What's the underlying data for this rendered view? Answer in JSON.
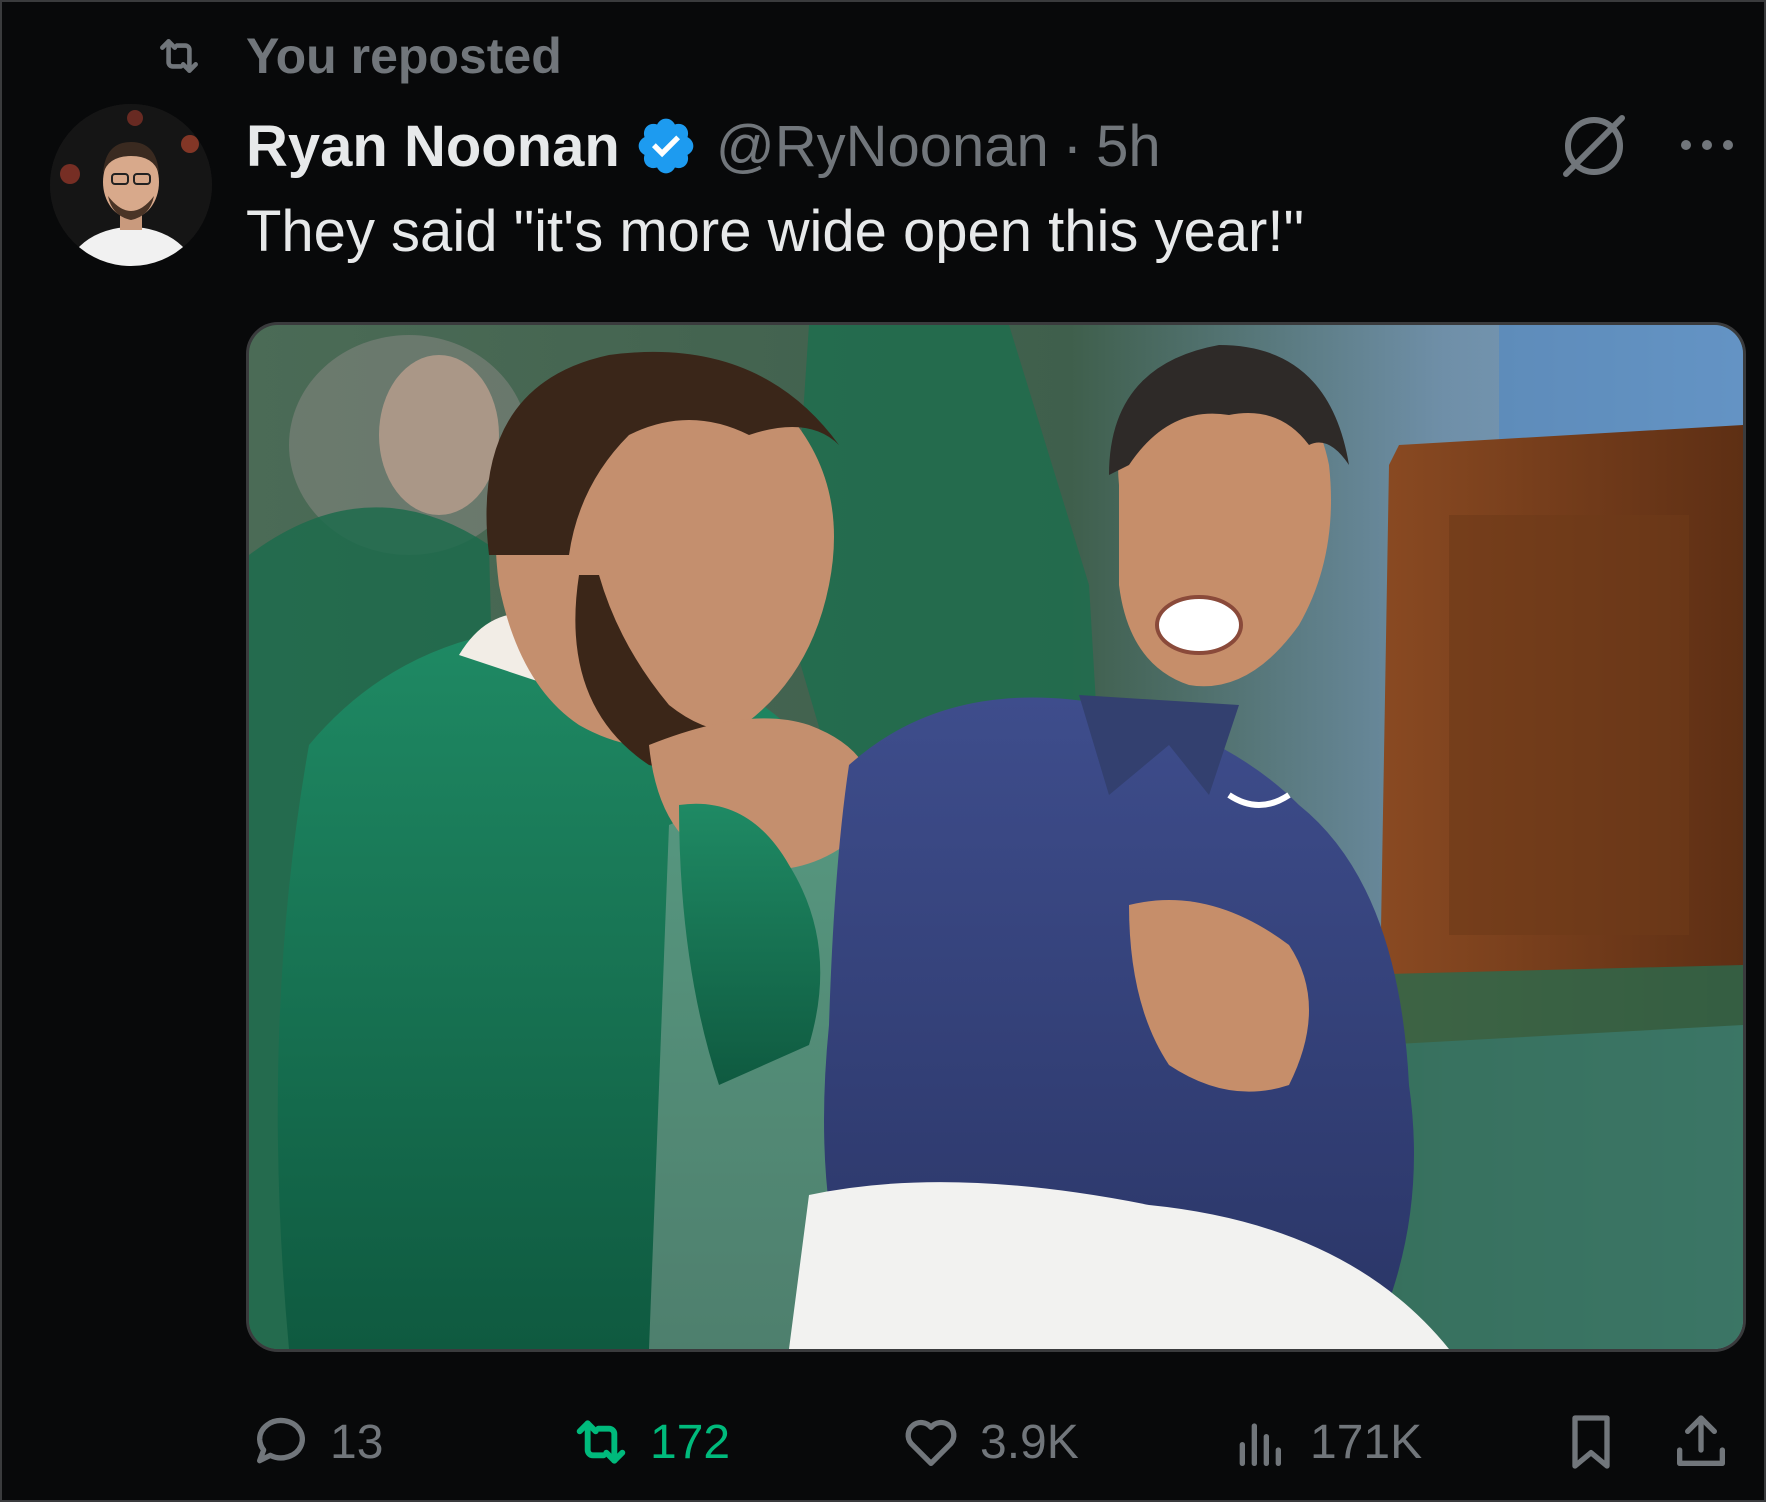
{
  "repost_banner": {
    "text": "You reposted",
    "icon": "repost-icon"
  },
  "author": {
    "name": "Ryan Noonan",
    "verified": true,
    "badge_color": "#1d9bf0",
    "handle": "@RyNoonan",
    "separator": "·",
    "time": "5h",
    "avatar_icon": "profile-avatar"
  },
  "tweet": {
    "text": "They said \"it's more wide open this year!\""
  },
  "header_actions": {
    "grok_icon": "grok-icon",
    "more_icon": "more-icon"
  },
  "media": {
    "type": "photo"
  },
  "actions": {
    "reply": {
      "icon": "reply-icon",
      "count": "13"
    },
    "repost": {
      "icon": "repost-icon",
      "count": "172",
      "active": true,
      "active_color": "#00ba7c"
    },
    "like": {
      "icon": "heart-icon",
      "count": "3.9K"
    },
    "views": {
      "icon": "views-icon",
      "count": "171K"
    },
    "bookmark": {
      "icon": "bookmark-icon"
    },
    "share": {
      "icon": "share-icon"
    }
  },
  "colors": {
    "background": "#08090a",
    "text_primary": "#e7e9ea",
    "text_secondary": "#71767b",
    "border": "#3a3b3d"
  }
}
